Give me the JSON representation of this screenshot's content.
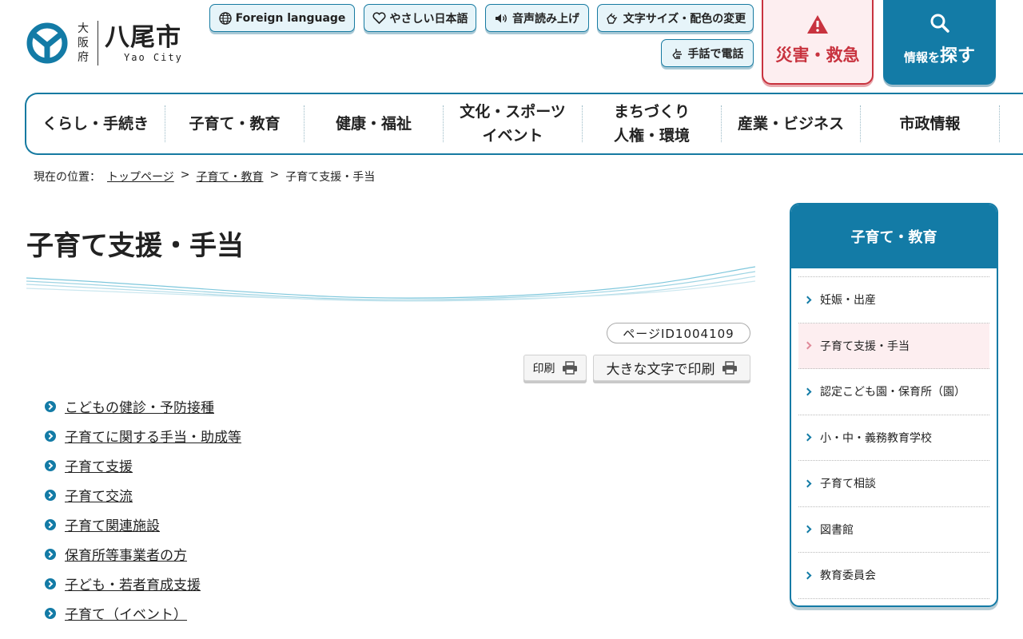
{
  "header": {
    "prefecture": "大阪府",
    "city_name": "八尾市",
    "city_name_en": "Yao City",
    "util_buttons": {
      "foreign": "Foreign language",
      "easy_japanese": "やさしい日本語",
      "read_aloud": "音声読み上げ",
      "text_size": "文字サイズ・配色の変更",
      "sign_phone": "手話で電話"
    },
    "emergency_label": "災害・救急",
    "search_label_small_1": "情報",
    "search_label_small_2": "を",
    "search_label_big": "探す"
  },
  "gnav": {
    "items": [
      {
        "line1": "くらし・手続き",
        "line2": ""
      },
      {
        "line1": "子育て・教育",
        "line2": ""
      },
      {
        "line1": "健康・福祉",
        "line2": ""
      },
      {
        "line1": "文化・スポーツ",
        "line2": "イベント"
      },
      {
        "line1": "まちづくり",
        "line2": "人権・環境"
      },
      {
        "line1": "産業・ビジネス",
        "line2": ""
      },
      {
        "line1": "市政情報",
        "line2": ""
      }
    ]
  },
  "breadcrumb": {
    "prefix": "現在の位置：",
    "items": [
      "トップページ",
      "子育て・教育",
      "子育て支援・手当"
    ],
    "separator": ">"
  },
  "main": {
    "title": "子育て支援・手当",
    "page_id": "ページID1004109",
    "print_label": "印刷",
    "print_large_label": "大きな文字で印刷",
    "links": [
      "こどもの健診・予防接種",
      "子育てに関する手当・助成等",
      "子育て支援",
      "子育て交流",
      "子育て関連施設",
      "保育所等事業者の方",
      "子ども・若者育成支援",
      "子育て（イベント）"
    ]
  },
  "sidebar": {
    "title": "子育て・教育",
    "items": [
      {
        "label": "妊娠・出産",
        "active": false
      },
      {
        "label": "子育て支援・手当",
        "active": true
      },
      {
        "label": "認定こども園・保育所（園）",
        "active": false
      },
      {
        "label": "小・中・義務教育学校",
        "active": false
      },
      {
        "label": "子育て相談",
        "active": false
      },
      {
        "label": "図書館",
        "active": false
      },
      {
        "label": "教育委員会",
        "active": false
      }
    ]
  },
  "colors": {
    "primary": "#137ba6",
    "emergency": "#c8333f",
    "active_bg": "#fdeef0"
  }
}
